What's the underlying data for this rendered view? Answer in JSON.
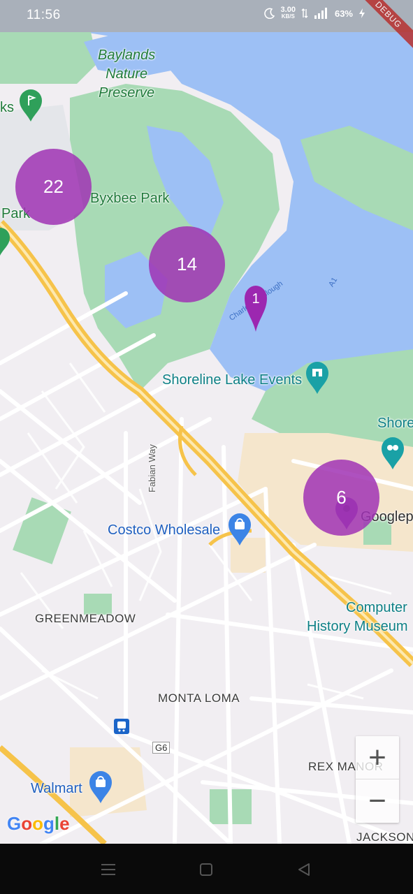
{
  "status_bar": {
    "time": "11:56",
    "net_speed": "3.00",
    "net_unit": "KB/S",
    "battery": "63%",
    "debug_banner": "DEBUG"
  },
  "map": {
    "labels": {
      "baylands": "Baylands\nNature\nPreserve",
      "byxbee": "Byxbee Park",
      "park_left": "Park",
      "ks_left": "ks",
      "shoreline_lake": "Shoreline Lake Events",
      "shore_right": "Shore",
      "fabian_way": "Fabian Way",
      "costco": "Costco Wholesale",
      "googleplex": "Googlep",
      "computer_history_line1": "Computer",
      "computer_history_line2": "History Museum",
      "greenmeadow": "GREENMEADOW",
      "monta_loma": "MONTA LOMA",
      "rex_manor": "REX MANOR",
      "jackson": "JACKSON",
      "walmart": "Walmart",
      "g6": "G6",
      "charleston_slough": "Charleston Slough",
      "a1": "A1"
    },
    "clusters": [
      {
        "count": "22"
      },
      {
        "count": "14"
      },
      {
        "count": "6"
      }
    ],
    "pin": {
      "count": "1"
    },
    "colors": {
      "water": "#9dc0f5",
      "park": "#a8dab5",
      "cluster": "#a032b4",
      "highway": "#f6c34a",
      "land": "#f1eef2"
    }
  },
  "zoom": {
    "in_label": "+",
    "out_label": "−"
  },
  "google_logo": {
    "G": "G",
    "o1": "o",
    "o2": "o",
    "g": "g",
    "l": "l",
    "e": "e"
  },
  "nav": {
    "menu_icon": "menu-icon",
    "home_icon": "home-icon",
    "back_icon": "back-icon"
  }
}
